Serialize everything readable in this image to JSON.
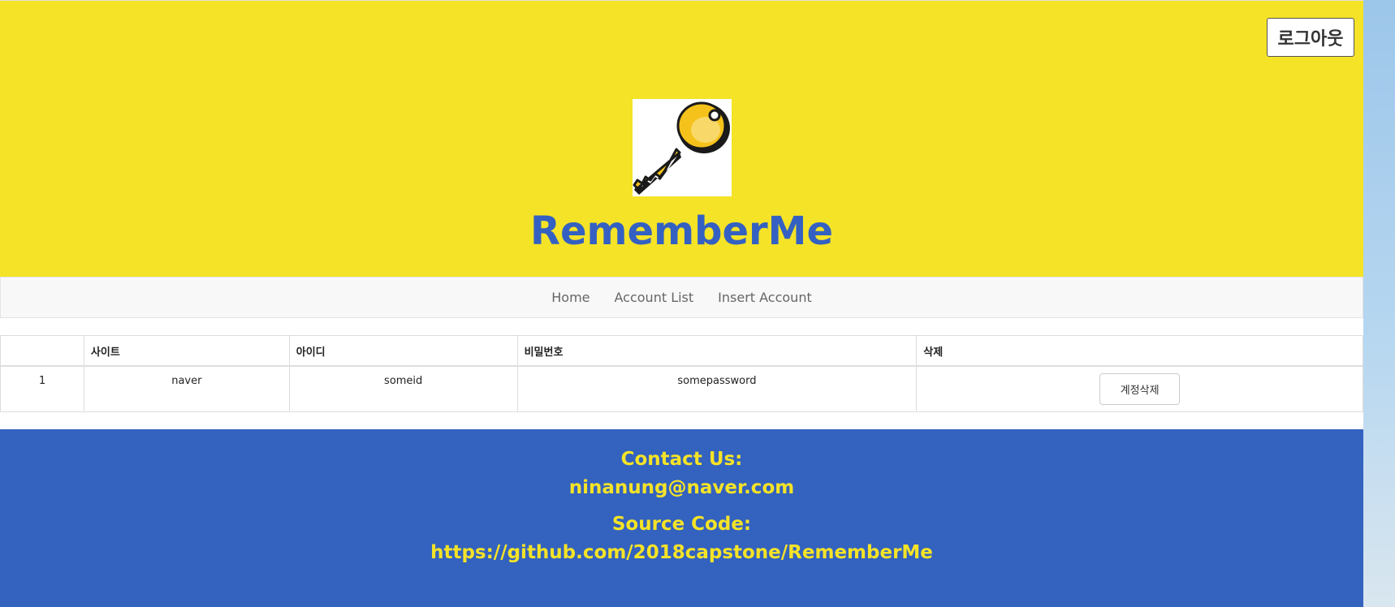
{
  "header": {
    "logout_label": "로그아웃",
    "app_title": "RememberMe",
    "logo_icon": "key-icon"
  },
  "nav": {
    "items": [
      {
        "label": "Home"
      },
      {
        "label": "Account List"
      },
      {
        "label": "Insert Account"
      }
    ]
  },
  "table": {
    "columns": [
      "",
      "사이트",
      "아이디",
      "비밀번호",
      "삭제"
    ],
    "rows": [
      {
        "index": "1",
        "site": "naver",
        "id": "someid",
        "password": "somepassword",
        "delete_label": "계정삭제"
      }
    ]
  },
  "footer": {
    "contact_label": "Contact Us:",
    "contact_email": "ninanung@naver.com",
    "source_label": "Source Code:",
    "source_url": "https://github.com/2018capstone/RememberMe"
  },
  "colors": {
    "header_bg": "#f5e327",
    "title": "#3461c1",
    "footer_bg": "#3362bf",
    "footer_text": "#f5e327"
  }
}
